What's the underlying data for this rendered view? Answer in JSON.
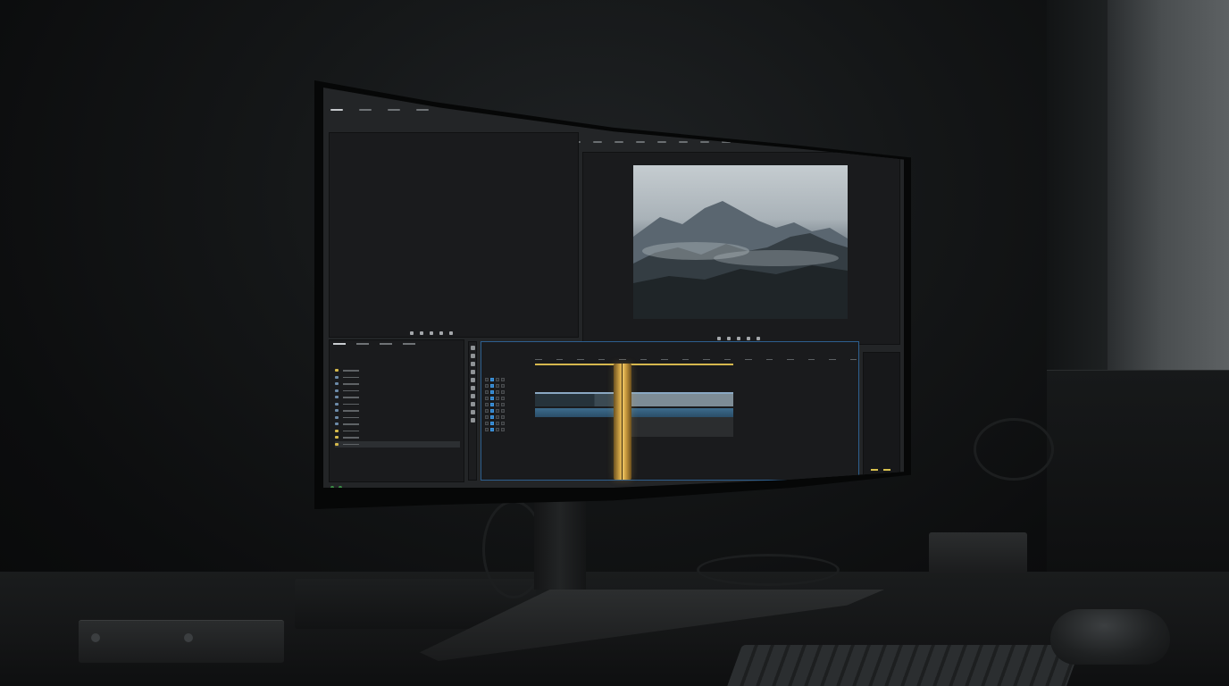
{
  "scene": {
    "colors": {
      "wall": "#141617",
      "screen_bg": "#232527",
      "panel_bg": "#1a1b1d",
      "accent_blue": "#4a9ad8",
      "playhead_gold": "#d4a747",
      "bin_yellow": "#d5b94b"
    },
    "icons": [
      "mouse-icon",
      "keyboard-icon",
      "monitor-icon"
    ]
  },
  "editor": {
    "menu_tabs": [
      {
        "icon": "tab-icon"
      },
      {
        "icon": "tab-icon"
      },
      {
        "icon": "tab-icon"
      },
      {
        "icon": "tab-icon"
      }
    ],
    "workspace_tabs": [
      {
        "icon": "workspace-tab-icon"
      },
      {
        "icon": "workspace-tab-icon"
      },
      {
        "icon": "workspace-tab-icon"
      },
      {
        "icon": "workspace-tab-icon"
      },
      {
        "icon": "workspace-tab-icon"
      },
      {
        "icon": "workspace-tab-icon"
      },
      {
        "icon": "workspace-tab-icon"
      },
      {
        "icon": "workspace-tab-icon"
      }
    ],
    "project_rows": [
      {
        "type": "bin"
      },
      {
        "type": "clip"
      },
      {
        "type": "clip"
      },
      {
        "type": "clip"
      },
      {
        "type": "clip"
      },
      {
        "type": "clip"
      },
      {
        "type": "clip"
      },
      {
        "type": "clip"
      },
      {
        "type": "clip"
      },
      {
        "type": "bin"
      },
      {
        "type": "bin"
      },
      {
        "type": "bin"
      }
    ],
    "track_count": 9,
    "tool_count": 10,
    "transport_icons": [
      "play-icon",
      "step-back-icon",
      "step-forward-icon",
      "loop-icon",
      "export-frame-icon"
    ]
  }
}
